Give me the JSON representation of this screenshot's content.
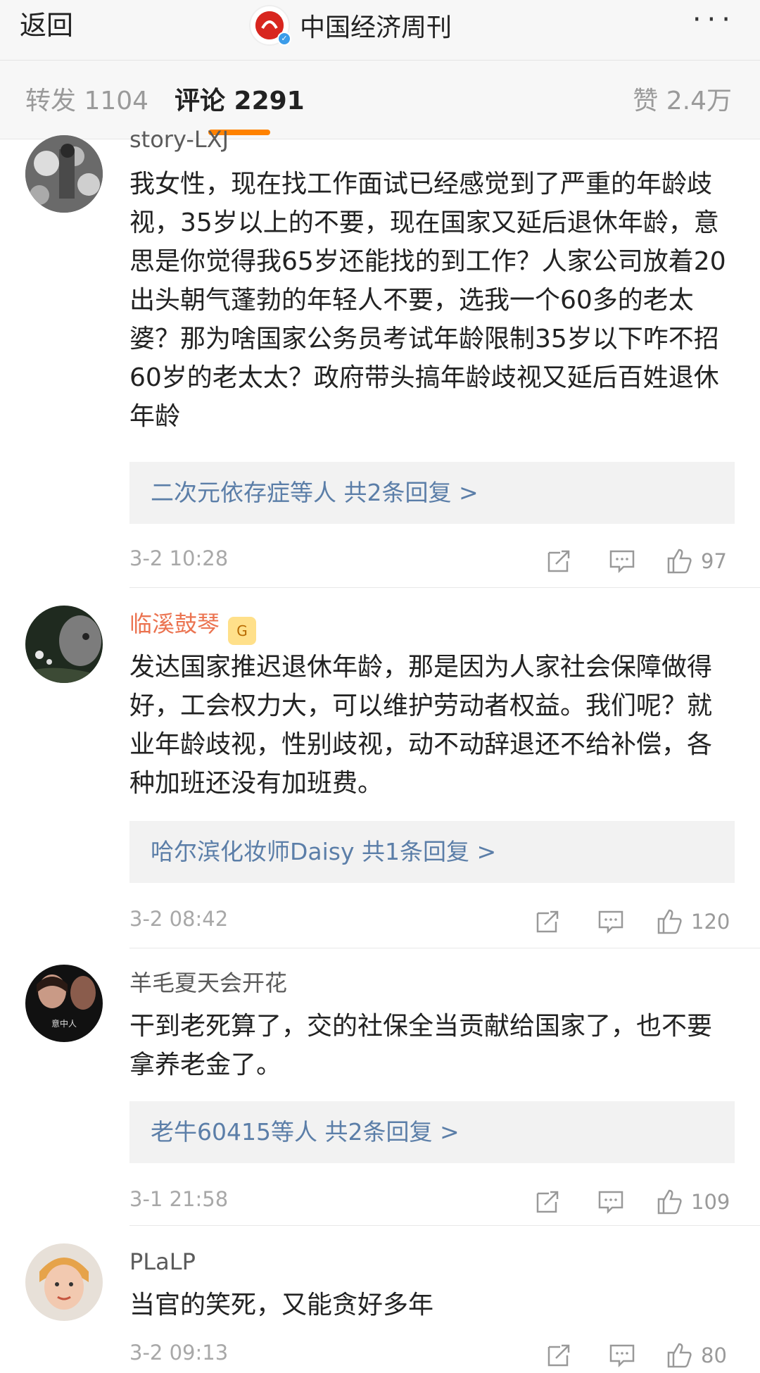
{
  "nav": {
    "back_label": "返回",
    "title": "中国经济周刊",
    "logo_text": "中国经济周刊",
    "more_label": "···"
  },
  "tabs": {
    "repost": "转发 1104",
    "comment": "评论 2291",
    "like": "赞 2.4万"
  },
  "comments": [
    {
      "author": "story-LXJ",
      "content": "我女性，现在找工作面试已经感觉到了严重的年龄歧视，35岁以上的不要，现在国家又延后退休年龄，意思是你觉得我65岁还能找的到工作？人家公司放着20出头朝气蓬勃的年轻人不要，选我一个60多的老太婆？那为啥国家公务员考试年龄限制35岁以下咋不招60岁的老太太？政府带头搞年龄歧视又延后百姓退休年龄",
      "replies": "二次元依存症等人  共2条回复 >",
      "time": "3-2 10:28",
      "likes": "97"
    },
    {
      "author": "临溪鼓琴",
      "badge": "G",
      "content": "发达国家推迟退休年龄，那是因为人家社会保障做得好，工会权力大，可以维护劳动者权益。我们呢？就业年龄歧视，性别歧视，动不动辞退还不给补偿，各种加班还没有加班费。",
      "replies": "哈尔滨化妆师Daisy  共1条回复 >",
      "time": "3-2 08:42",
      "likes": "120"
    },
    {
      "author": "羊毛夏天会开花",
      "avatar_text": "意中人",
      "content": "干到老死算了，交的社保全当贡献给国家了，也不要拿养老金了。",
      "replies": "老牛60415等人  共2条回复 >",
      "time": "3-1 21:58",
      "likes": "109"
    },
    {
      "author": "PLaLP",
      "content": "当官的笑死，又能贪好多年",
      "time": "3-2 09:13",
      "likes": "80"
    }
  ],
  "colors": {
    "accent": "#ff8200",
    "link": "#5b7ea8",
    "vip_name": "#eb7350"
  }
}
